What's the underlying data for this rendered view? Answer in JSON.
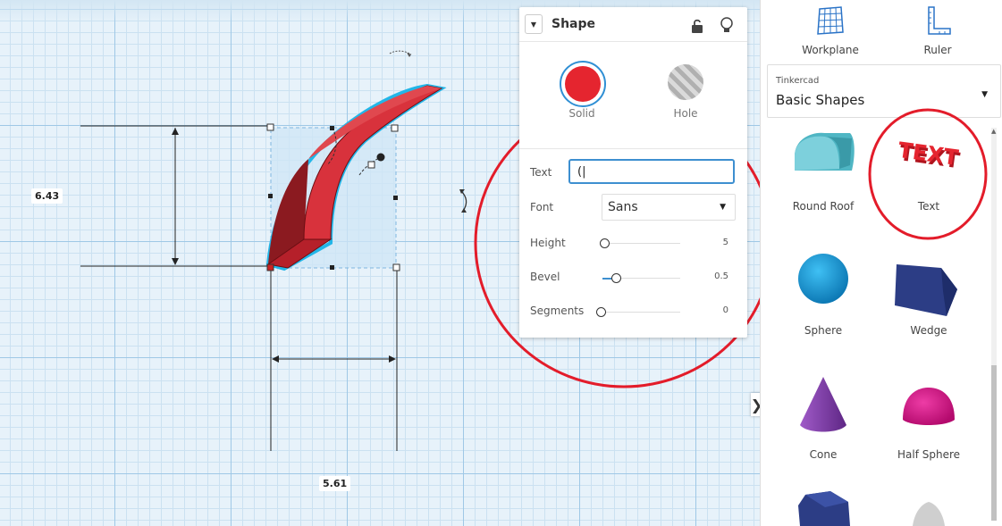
{
  "canvas": {
    "dim_height": "6.43",
    "dim_width": "5.61"
  },
  "inspector": {
    "title": "Shape",
    "solid_label": "Solid",
    "hole_label": "Hole",
    "text_label": "Text",
    "text_value": "(|",
    "font_label": "Font",
    "font_value": "Sans",
    "height_label": "Height",
    "height_value": "5",
    "bevel_label": "Bevel",
    "bevel_value": "0.5",
    "segments_label": "Segments",
    "segments_value": "0",
    "colors": {
      "solid": "#e5252f",
      "highlight_ring": "#e31c2a",
      "accent": "#3d8fd0"
    }
  },
  "panel": {
    "workplane_label": "Workplane",
    "ruler_label": "Ruler",
    "library_small": "Tinkercad",
    "library_selected": "Basic Shapes",
    "shapes": [
      {
        "label": "Round Roof"
      },
      {
        "label": "Text"
      },
      {
        "label": "Sphere"
      },
      {
        "label": "Wedge"
      },
      {
        "label": "Cone"
      },
      {
        "label": "Half Sphere"
      }
    ]
  }
}
